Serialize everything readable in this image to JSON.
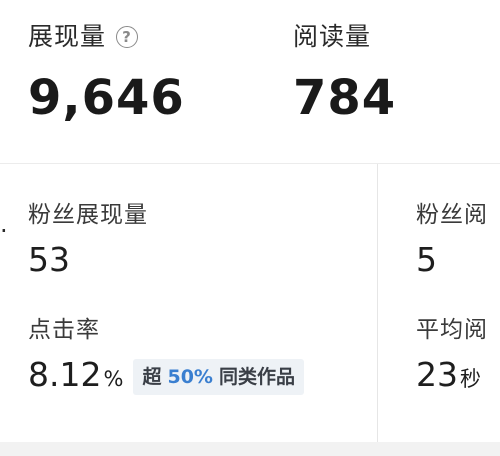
{
  "summary": {
    "impressions": {
      "label": "展现量",
      "value": "9,646"
    },
    "reads": {
      "label": "阅读量",
      "value": "784"
    }
  },
  "left": {
    "marker": ".",
    "fan_impressions": {
      "label": "粉丝展现量",
      "value": "53"
    },
    "ctr": {
      "label": "点击率",
      "value": "8.12",
      "unit": "%",
      "badge": {
        "prefix": "超",
        "highlight": "50%",
        "suffix": "同类作品"
      }
    }
  },
  "right": {
    "fan_reads": {
      "label": "粉丝阅",
      "value": "5"
    },
    "avg_read": {
      "label": "平均阅",
      "value": "23",
      "unit": "秒"
    }
  },
  "colors": {
    "highlight": "#3a7fd0",
    "badge_bg": "#eef2f6",
    "text": "#1e1e1e"
  }
}
